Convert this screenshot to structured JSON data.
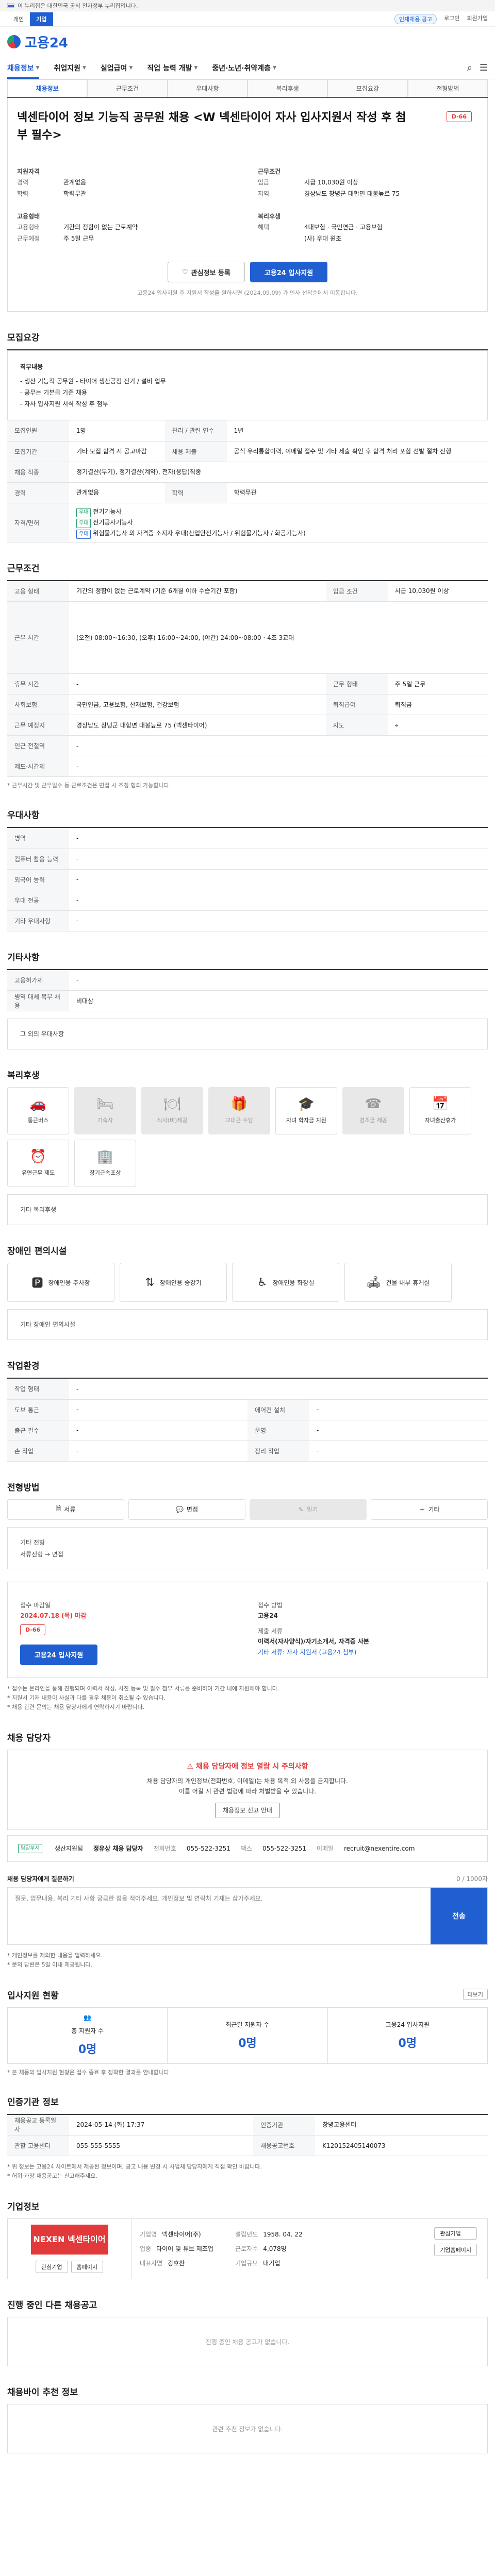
{
  "gov_banner": "이 누리집은 대한민국 공식 전자정부 누리집입니다.",
  "topbar": {
    "tabs": [
      "개인",
      "기업"
    ],
    "chip": "인재채용 공고",
    "links": [
      "로그인",
      "회원가입"
    ]
  },
  "logo": "고용24",
  "nav": {
    "items": [
      "채용정보",
      "취업지원",
      "실업급여",
      "직업 능력 개발",
      "중년·노년·취약계층"
    ]
  },
  "subtabs": [
    "채용정보",
    "근무조건",
    "우대사항",
    "복리후생",
    "모집요강",
    "전형방법"
  ],
  "title": "넥센타이어 정보 기능직 공무원 채용 <W 넥센타이어 자사 입사지원서 작성 후 첨부 필수>",
  "dday": "D-66",
  "summary": {
    "col1": [
      {
        "k": "지원자격",
        "v": ""
      },
      {
        "k": "경력",
        "v": "관계없음"
      },
      {
        "k": "학력",
        "v": "학력무관"
      },
      {
        "k": "고용형태",
        "v": ""
      },
      {
        "k": "고용형태",
        "v": "기간의 정함이 없는 근로계약"
      },
      {
        "k": "근무예정",
        "v": "주 5일 근무"
      }
    ],
    "col2": [
      {
        "k": "근무조건",
        "v": ""
      },
      {
        "k": "임금",
        "v": "시급 10,030원 이상"
      },
      {
        "k": "지역",
        "v": "경상남도 창녕군 대합면 대봉늪로 75"
      },
      {
        "k": "복리후생",
        "v": ""
      },
      {
        "k": "혜택",
        "v": "4대보험 · 국민연금 · 고용보험"
      },
      {
        "k": "",
        "v": "(사) 우대 원조"
      }
    ]
  },
  "buttons": {
    "scrap": "관심정보 등록",
    "apply": "고용24 입사지원"
  },
  "apply_note": "고용24 입사지원 후 지원서 작성을 원하시면 (2024.09.09) 가 인사 선착순에서 이동합니다.",
  "sec_detail": "모집요강",
  "detail_box": {
    "heading": "직무내용",
    "lines": [
      "- 생산 기능직 공무원 - 타이어 생산공정 전기 / 설비 업무",
      "- 공무는 기본급 기준 채용",
      "- 자사 입사지원 서식 작성 후 첨부"
    ]
  },
  "recruit_table": [
    {
      "k": "모집인원",
      "v": "1명",
      "k2": "관리 / 관련 연수",
      "v2": "1년"
    },
    {
      "k": "모집기간",
      "v": "기타 모집 합격 시 공고마감",
      "k2": "채용 제출",
      "v2": "공식 우리통합이력, 이메일 접수 및 기타 제출 확인 후 합격 처리 포함 선발 절차 진행"
    },
    {
      "k": "채용 직종",
      "v": "정기결산(무기), 정기결산(계약), 전자(응답)직종",
      "k2": "",
      "v2": ""
    },
    {
      "k": "경력",
      "v": "관계없음",
      "k2": "학력",
      "v2": "학력무관"
    }
  ],
  "license": {
    "k": "자격/면허",
    "tag1": "우대",
    "v1": "전기기능사",
    "tag2": "우대",
    "v2": "전기공사기능사",
    "tag3": "우대",
    "v3": "위험물기능사 외 자격증 소지자 우대(산업안전기능사 / 위험물기능사 / 화공기능사)"
  },
  "sec_conditions": "근무조건",
  "cond_table": [
    {
      "k": "고용 형태",
      "v": "기간의 정함이 없는 근로계약 (기준 6개월 이하 수습기간 포함)",
      "k2": "임금 조건",
      "v2": "시급 10,030원 이상"
    },
    {
      "k": "근무 시간",
      "v": "(오전) 08:00~16:30, (오후) 16:00~24:00, (야간) 24:00~08:00 · 4조 3교대",
      "k2": "",
      "v2": ""
    },
    {
      "k": "휴무 시간",
      "v": "-",
      "k2": "근무 형태",
      "v2": "주 5일 근무"
    },
    {
      "k": "사회보험",
      "v": "국민연금, 고용보험, 산재보험, 건강보험",
      "k2": "퇴직급여",
      "v2": "퇴직금"
    },
    {
      "k": "근무 예정지",
      "v": "경상남도 창녕군 대합면 대봉늪로 75 (넥센타이어)",
      "k2": "지도",
      "v2": ""
    },
    {
      "k": "인근 전철역",
      "v": "-",
      "k2": "",
      "v2": ""
    },
    {
      "k": "제도·시간제",
      "v": "-",
      "k2": "",
      "v2": ""
    }
  ],
  "cond_note": "* 근무시간 및 근무일수 등 근로조건은 면접 시 조정 협의 가능합니다.",
  "sec_pref": "우대사항",
  "pref_table": [
    {
      "k": "병역",
      "v": "-"
    },
    {
      "k": "컴퓨터 활용 능력",
      "v": "-"
    },
    {
      "k": "외국어 능력",
      "v": "-"
    },
    {
      "k": "우대 전공",
      "v": "-"
    },
    {
      "k": "기타 우대사항",
      "v": "-"
    }
  ],
  "sec_etc": "기타사항",
  "etc_table": [
    {
      "k": "고용허가제",
      "v": "-"
    },
    {
      "k": "병역 대체 복무 채용",
      "v": "비대상"
    }
  ],
  "etc_frame_label": "그 외의 우대사항",
  "sec_welfare": "복리후생",
  "welfare_icons": [
    {
      "icon": "car-icon",
      "label": "통근버스",
      "on": true
    },
    {
      "icon": "bus-icon",
      "label": "기숙사",
      "on": false
    },
    {
      "icon": "meal-icon",
      "label": "식사(비)제공",
      "on": false
    },
    {
      "icon": "gift-icon",
      "label": "교대근 수당",
      "on": false
    },
    {
      "icon": "grad-icon",
      "label": "자녀 학자금 지원",
      "on": true
    },
    {
      "icon": "phone-icon",
      "label": "경조금 제공",
      "on": false
    },
    {
      "icon": "calendar-icon",
      "label": "자녀출산휴가",
      "on": true
    },
    {
      "icon": "clock-icon",
      "label": "유연근무 제도",
      "on": true
    },
    {
      "icon": "building-icon",
      "label": "장기근속포상",
      "on": true
    }
  ],
  "welfare_frame_label": "기타 복리후생",
  "sec_disab": "장애인 편의시설",
  "disab_icons": [
    "장애인용 주차장",
    "장애인용 승강기",
    "장애인용 화장실",
    "건물 내부 휴게실"
  ],
  "disab_frame_label": "기타 장애인 편의시설",
  "sec_env": "작업환경",
  "env_table": [
    {
      "k": "작업 형태",
      "v": "-",
      "k2": "",
      "v2": ""
    },
    {
      "k": "도보 통근",
      "v": "-",
      "k2": "에어컨 설치",
      "v2": "-"
    },
    {
      "k": "출근 필수",
      "v": "-",
      "k2": "운영",
      "v2": "-"
    },
    {
      "k": "손 작업",
      "v": "-",
      "k2": "정리 작업",
      "v2": "-"
    }
  ],
  "sec_screen": "전형방법",
  "screen_opts": [
    {
      "icon": "doc-icon",
      "label": "서류",
      "on": true
    },
    {
      "icon": "chat-icon",
      "label": "면접",
      "on": true
    },
    {
      "icon": "pen-icon",
      "label": "필기",
      "on": false
    },
    {
      "icon": "plus-icon",
      "label": "기타",
      "on": true
    }
  ],
  "screen_frame_label": "기타 전형",
  "screen_frame_val": "서류전형 → 면접",
  "apply_box": {
    "left_lbl1": "접수 마감일",
    "left_val1": "2024.07.18 (목) 마감",
    "left_badge": "D-66",
    "right_lbl1": "접수 방법",
    "right_val1": "고용24",
    "right_lbl2": "제출 서류",
    "right_val2": "이력서(자사양식)/자기소개서, 자격증 사본",
    "right_lbl3": "",
    "right_val3": "기타 서류: 자사 지원서 (고용24 첨부)",
    "apply_btn": "고용24 입사지원"
  },
  "apply_notes": [
    "* 접수는 온라인을 통해 진행되며 이력서 작성, 사진 등록 및 필수 첨부 서류를 준비하여 기간 내에 지원해야 합니다.",
    "* 지원서 기재 내용이 사실과 다를 경우 채용이 취소될 수 있습니다.",
    "* 채용 관련 문의는 채용 담당자에게 연락하시기 바랍니다."
  ],
  "sec_mgr": "채용 담당자",
  "warn": {
    "head": "채용 담당자에 정보 열람 시 주의사항",
    "lines": [
      "채용 담당자의 개인정보(전화번호, 이메일)는 채용 목적 외 사용을 금지합니다.",
      "이를 어길 시 관련 법령에 따라 처벌받을 수 있습니다."
    ],
    "btn": "채용정보 신고 안내"
  },
  "mgr": {
    "tag": "담당부서",
    "dept": "생산지원팀",
    "name": "정유상 채용 담당자",
    "tel_lbl": "전화번호",
    "tel": "055-522-3251",
    "fax_lbl": "팩스",
    "fax": "055-522-3251",
    "email_lbl": "이메일",
    "email": "recruit@nexentire.com"
  },
  "qa": {
    "label": "채용 담당자에게 질문하기",
    "placeholder": "질문, 업무내용, 복리 기타 사항 궁금한 점을 적어주세요. 개인정보 및 연락처 기재는 삼가주세요.",
    "count": "0 / 1000자",
    "btn": "전송",
    "notes": [
      "* 개인정보를 제외한 내용을 입력하세요.",
      "* 문의 답변은 5일 이내 제공됩니다."
    ]
  },
  "sec_stats": "입사지원 현황",
  "stats_more": "더보기",
  "stats": [
    {
      "label": "총 지원자 수",
      "val": "0명"
    },
    {
      "label": "최근일 지원자 수",
      "val": "0명"
    },
    {
      "label": "고용24 입사지원",
      "val": "0명"
    }
  ],
  "stats_note": "* 본 채용의 입사지원 현황은 접수 종료 후 정확한 결과를 안내합니다.",
  "sec_info": "인증기관 정보",
  "info_table": [
    {
      "k": "채용공고 등록일자",
      "v": "2024-05-14 (화) 17:37",
      "k2": "인증기관",
      "v2": "창녕고용센터"
    },
    {
      "k": "관할 고용센터",
      "v": "055-555-5555",
      "k2": "채용공고번호",
      "v2": "K120152405140073"
    }
  ],
  "info_notes": [
    "* 위 정보는 고용24 사이트에서 제공된 정보이며, 공고 내용 변경 시 사업체 담당자에게 직접 확인 바랍니다.",
    "* 허위·과장 채용공고는 신고해주세요."
  ],
  "sec_company": "기업정보",
  "company": {
    "logo": "NEXEN 넥센타이어",
    "btn1": "관심기업",
    "btn2": "홈페이지",
    "rows": [
      {
        "k": "기업명",
        "v": "넥센타이어(주)"
      },
      {
        "k": "업종",
        "v": "타이어 및 튜브 제조업"
      },
      {
        "k": "대표자명",
        "v": "강호찬"
      },
      {
        "k": "설립년도",
        "v": "1958. 04. 22"
      },
      {
        "k": "근로자수",
        "v": "4,078명"
      },
      {
        "k": "기업규모",
        "v": "대기업"
      }
    ],
    "side": [
      "관심기업",
      "기업홈페이지"
    ]
  },
  "sec_other": "진행 중인 다른 채용공고",
  "other_empty": "진행 중인 채용 공고가 없습니다.",
  "sec_near": "채용바이 추천 정보",
  "near_empty": "관련 추천 정보가 없습니다."
}
